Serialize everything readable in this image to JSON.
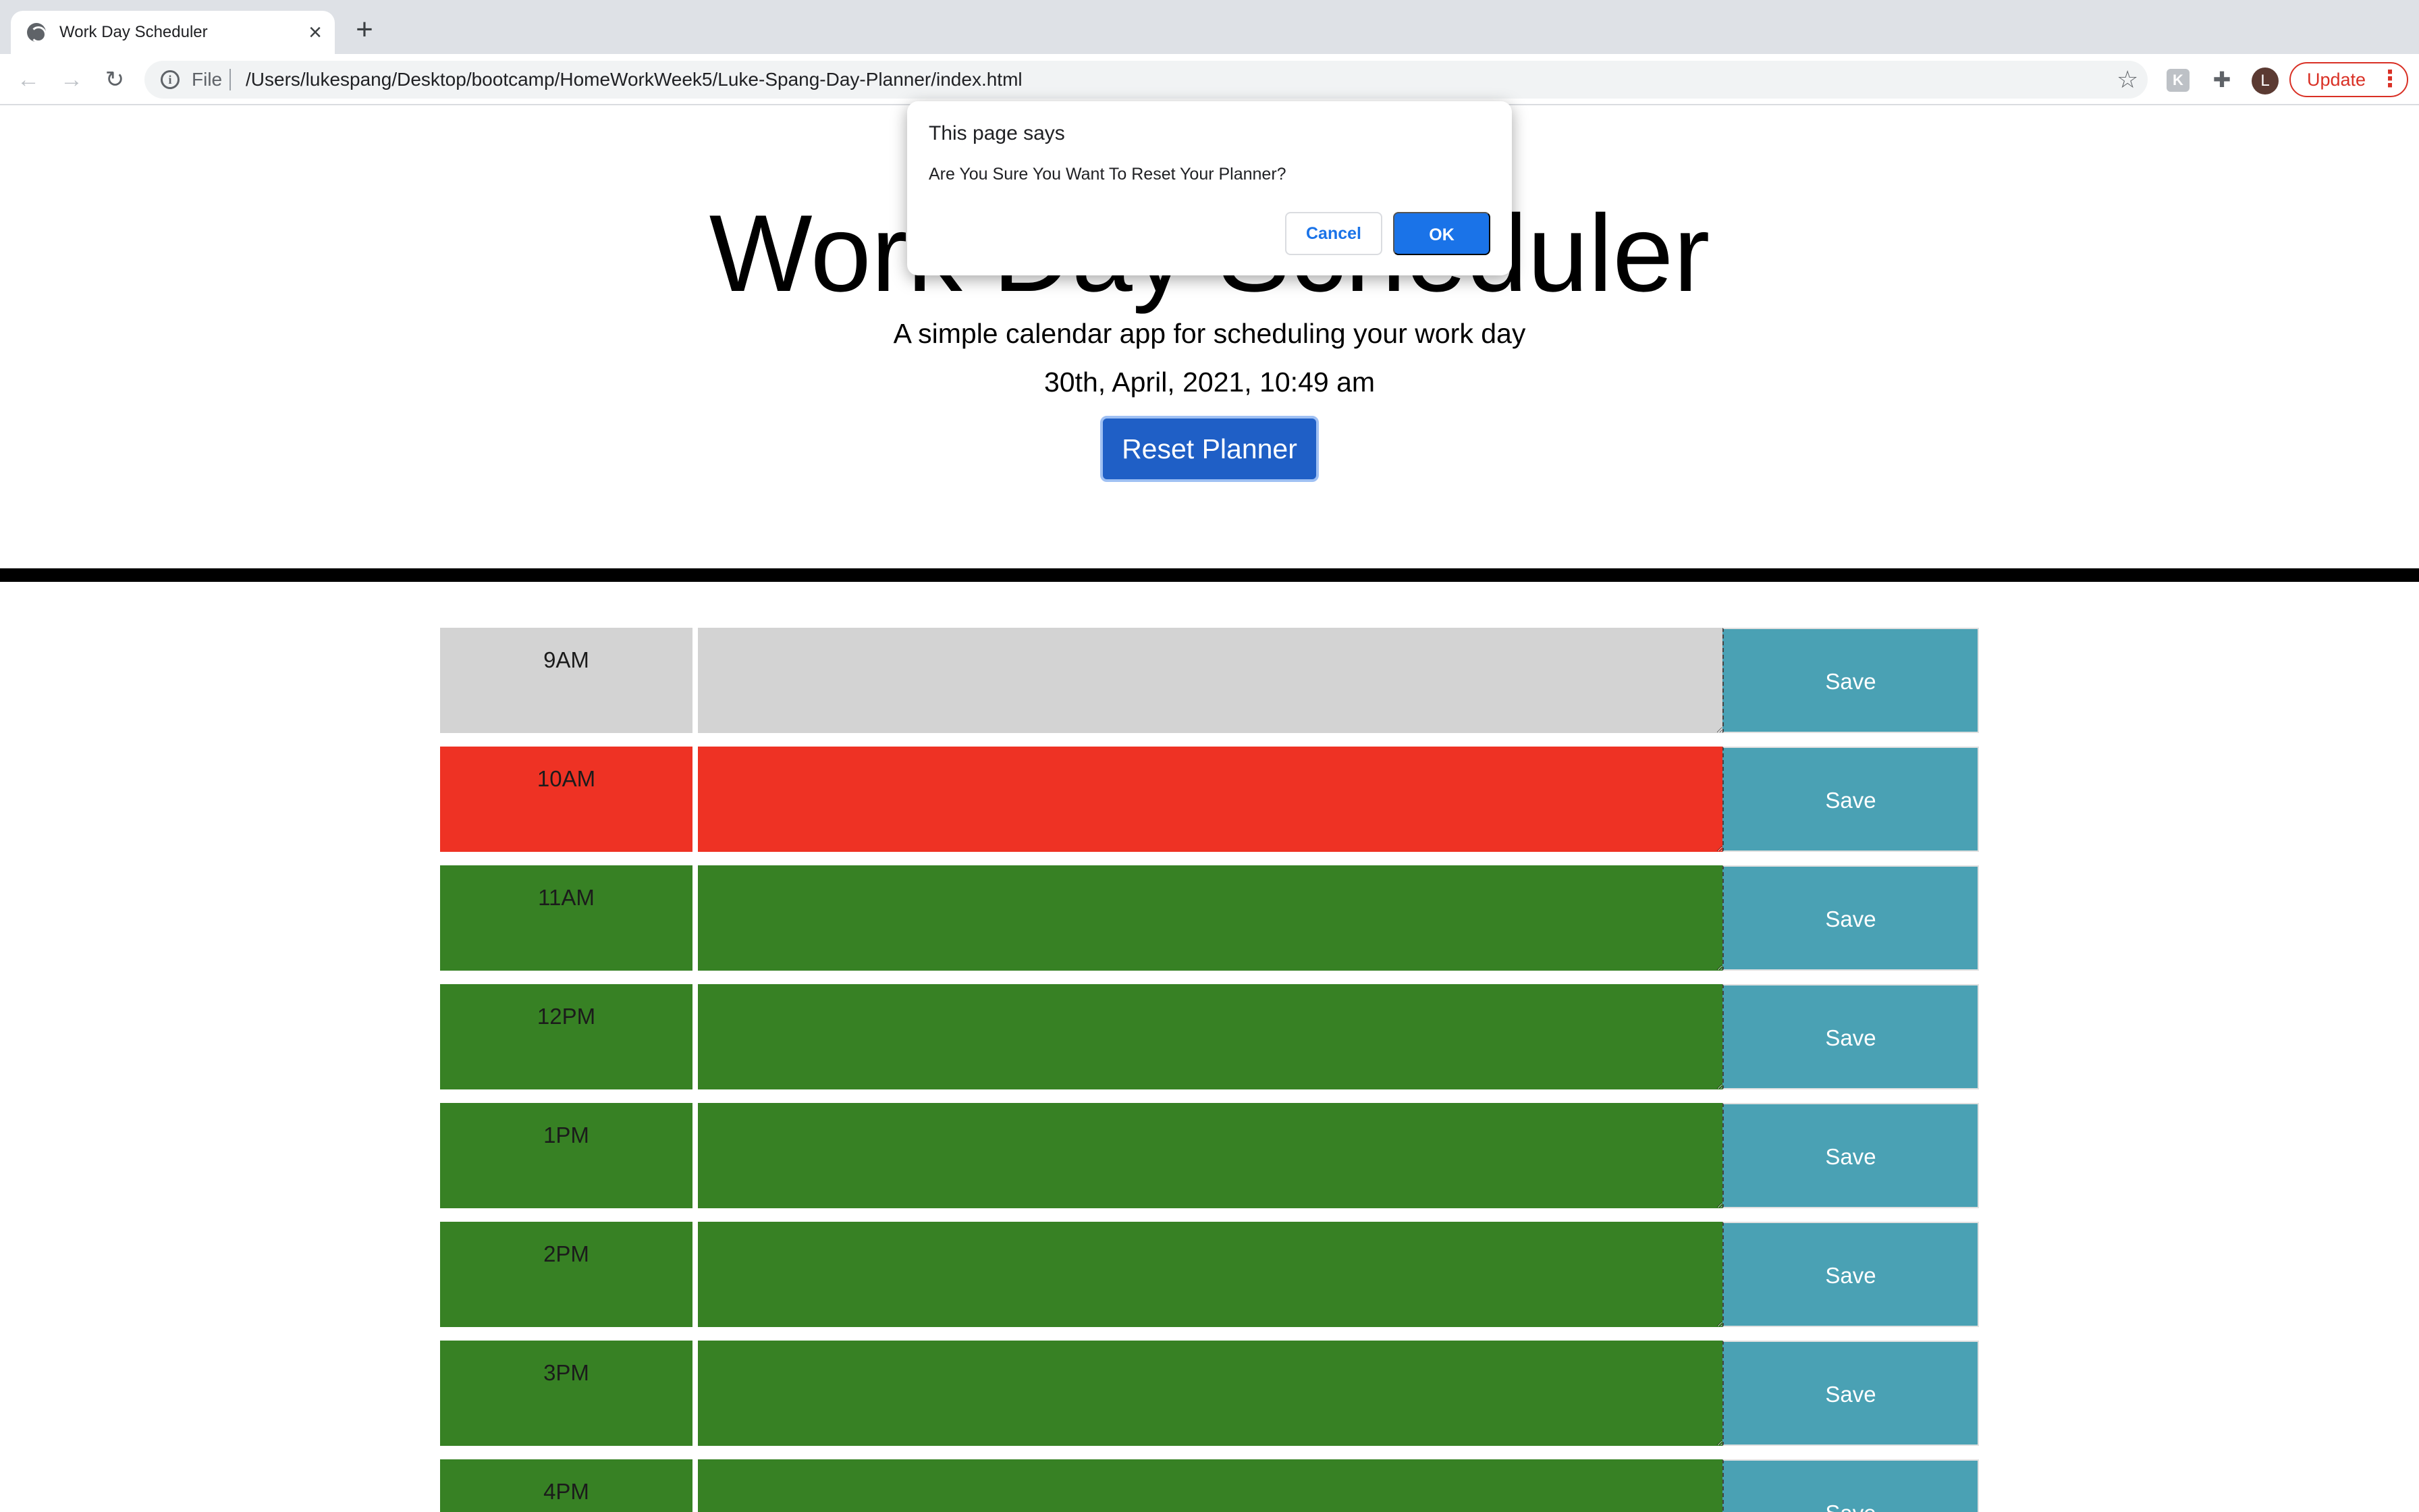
{
  "browser": {
    "tab_title": "Work Day Scheduler",
    "tab_close": "×",
    "new_tab": "+",
    "scheme_label": "File",
    "url": "/Users/lukespang/Desktop/bootcamp/HomeWorkWeek5/Luke-Spang-Day-Planner/index.html",
    "profile_initial": "L",
    "update_label": "Update",
    "icons": {
      "back": "←",
      "forward": "→",
      "reload": "↻",
      "info": "i",
      "star": "☆",
      "extension_k": "K",
      "puzzle": "✚",
      "kebab": "⋮"
    }
  },
  "header": {
    "title": "Work Day Scheduler",
    "subtitle": "A simple calendar app for scheduling your work day",
    "date": "30th, April, 2021, 10:49 am",
    "reset_label": "Reset Planner"
  },
  "planner": {
    "save_label": "Save",
    "rows": [
      {
        "hour": "9AM",
        "status": "past",
        "text": ""
      },
      {
        "hour": "10AM",
        "status": "present",
        "text": ""
      },
      {
        "hour": "11AM",
        "status": "future",
        "text": ""
      },
      {
        "hour": "12PM",
        "status": "future",
        "text": ""
      },
      {
        "hour": "1PM",
        "status": "future",
        "text": ""
      },
      {
        "hour": "2PM",
        "status": "future",
        "text": ""
      },
      {
        "hour": "3PM",
        "status": "future",
        "text": ""
      },
      {
        "hour": "4PM",
        "status": "future",
        "text": ""
      }
    ]
  },
  "colors": {
    "past": "#d3d3d3",
    "present": "#ee3224",
    "future": "#378124",
    "save": "#4aa1b4",
    "reset_button": "#1f5fc6"
  },
  "dialog": {
    "origin": "This page says",
    "message": "Are You Sure You Want To Reset Your Planner?",
    "cancel_label": "Cancel",
    "ok_label": "OK"
  }
}
